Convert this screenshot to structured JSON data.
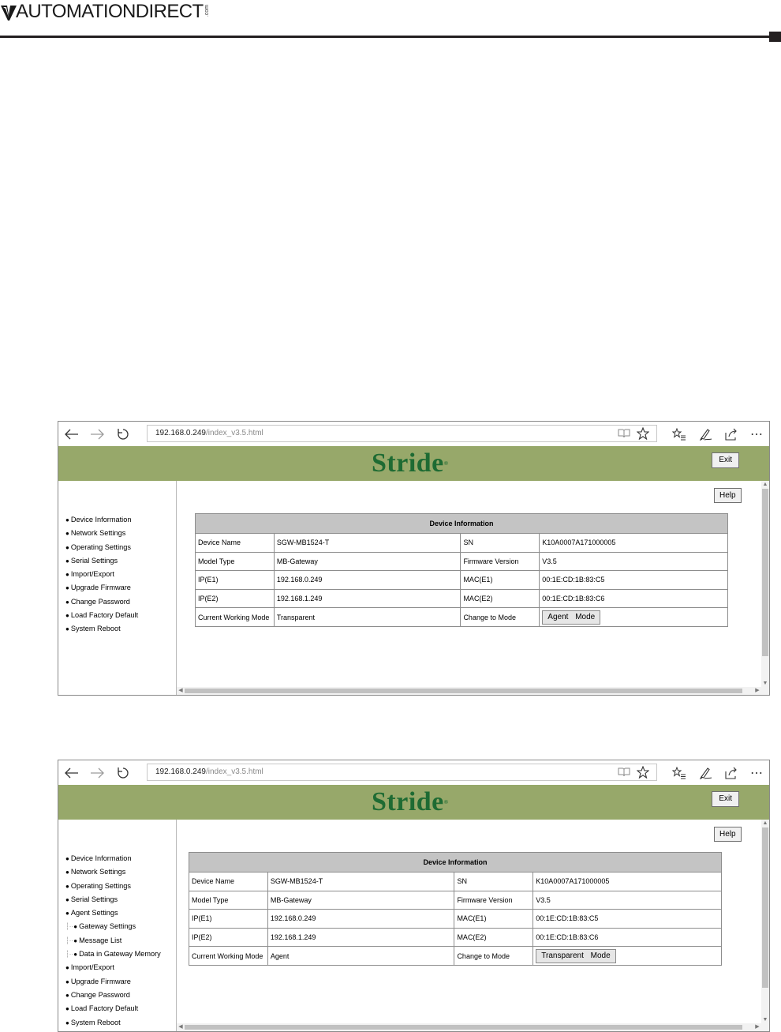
{
  "header": {
    "logo_text": "AUTOMATIONDIRECT",
    "logo_suffix": ".com"
  },
  "colors": {
    "banner": "#97a86a",
    "brand": "#1e6b33",
    "table_header": "#c4c4c4"
  },
  "icons": {
    "back": "arrow-left-icon",
    "forward": "arrow-right-icon",
    "refresh": "refresh-icon",
    "reading_view": "book-icon",
    "favorite": "star-icon",
    "favorites_hub": "favorites-list-icon",
    "notes": "pen-icon",
    "share": "share-icon",
    "more": "ellipsis-icon"
  },
  "browser1": {
    "url_host": "192.168.0.249",
    "url_path": "/index_v3.5.html",
    "more_glyph": "⋯",
    "brand_text": "Stride",
    "brand_mark": "®",
    "exit_label": "Exit",
    "help_label": "Help",
    "sidebar": [
      {
        "label": "Device Information"
      },
      {
        "label": "Network Settings"
      },
      {
        "label": "Operating Settings"
      },
      {
        "label": "Serial Settings"
      },
      {
        "label": "Import/Export"
      },
      {
        "label": "Upgrade Firmware"
      },
      {
        "label": "Change Password"
      },
      {
        "label": "Load Factory Default"
      },
      {
        "label": "System Reboot"
      }
    ],
    "table": {
      "title": "Device Information",
      "rows": [
        {
          "l1": "Device Name",
          "v1": "SGW-MB1524-T",
          "l2": "SN",
          "v2": "K10A0007A171000005"
        },
        {
          "l1": "Model Type",
          "v1": "MB-Gateway",
          "l2": "Firmware Version",
          "v2": "V3.5"
        },
        {
          "l1": "IP(E1)",
          "v1": "192.168.0.249",
          "l2": "MAC(E1)",
          "v2": "00:1E:CD:1B:83:C5"
        },
        {
          "l1": "IP(E2)",
          "v1": "192.168.1.249",
          "l2": "MAC(E2)",
          "v2": "00:1E:CD:1B:83:C6"
        },
        {
          "l1": "Current Working Mode",
          "v1": "Transparent",
          "l2": "Change to Mode",
          "button": "Agent Mode"
        }
      ]
    }
  },
  "browser2": {
    "url_host": "192.168.0.249",
    "url_path": "/index_v3.5.html",
    "more_glyph": "⋯",
    "brand_text": "Stride",
    "brand_mark": "®",
    "exit_label": "Exit",
    "help_label": "Help",
    "sidebar": [
      {
        "label": "Device Information"
      },
      {
        "label": "Network Settings"
      },
      {
        "label": "Operating Settings"
      },
      {
        "label": "Serial Settings"
      },
      {
        "label": "Agent Settings"
      },
      {
        "label": "Gateway Settings",
        "sub": true
      },
      {
        "label": "Message List",
        "sub": true
      },
      {
        "label": "Data in Gateway Memory",
        "sub": true
      },
      {
        "label": "Import/Export"
      },
      {
        "label": "Upgrade Firmware"
      },
      {
        "label": "Change Password"
      },
      {
        "label": "Load Factory Default"
      },
      {
        "label": "System Reboot"
      }
    ],
    "table": {
      "title": "Device Information",
      "rows": [
        {
          "l1": "Device Name",
          "v1": "SGW-MB1524-T",
          "l2": "SN",
          "v2": "K10A0007A171000005"
        },
        {
          "l1": "Model Type",
          "v1": "MB-Gateway",
          "l2": "Firmware Version",
          "v2": "V3.5"
        },
        {
          "l1": "IP(E1)",
          "v1": "192.168.0.249",
          "l2": "MAC(E1)",
          "v2": "00:1E:CD:1B:83:C5"
        },
        {
          "l1": "IP(E2)",
          "v1": "192.168.1.249",
          "l2": "MAC(E2)",
          "v2": "00:1E:CD:1B:83:C6"
        },
        {
          "l1": "Current Working Mode",
          "v1": "Agent",
          "l2": "Change to Mode",
          "button": "Transparent Mode"
        }
      ]
    }
  }
}
